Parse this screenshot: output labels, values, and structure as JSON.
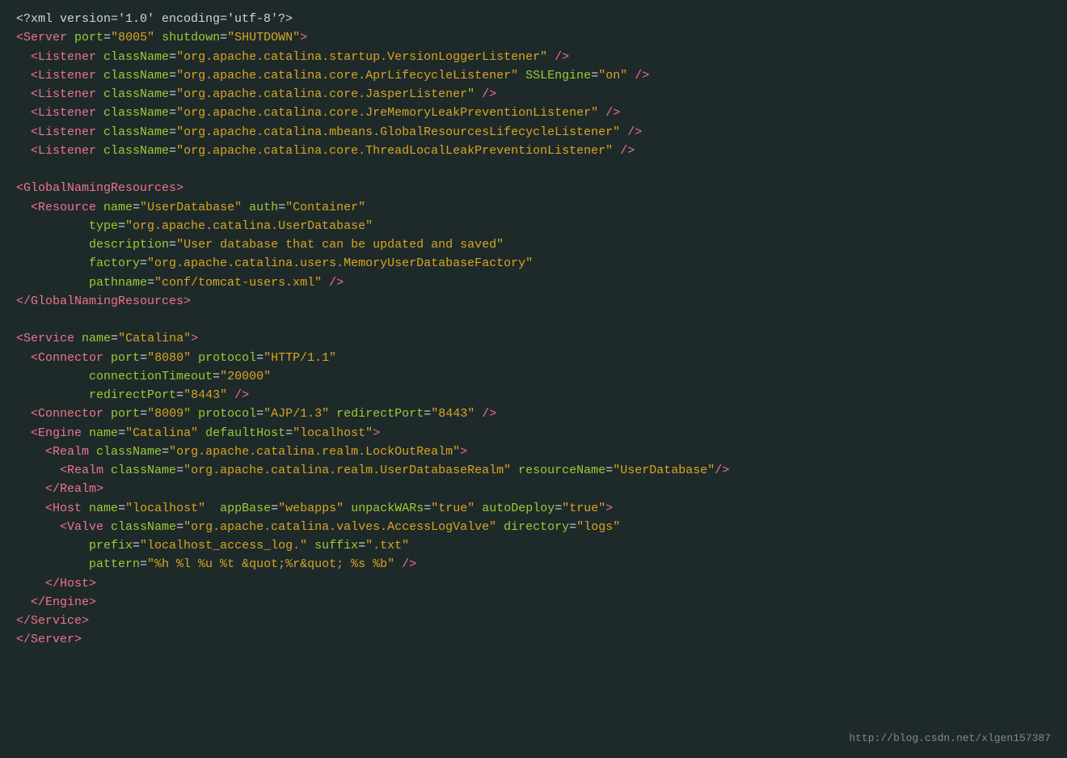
{
  "watermark": "http://blog.csdn.net/xlgen157387",
  "lines": [
    {
      "type": "prolog",
      "text": "<?xml version='1.0' encoding='utf-8'?>"
    },
    {
      "type": "mixed",
      "parts": [
        {
          "t": "tag",
          "v": "<Server"
        },
        {
          "t": "plain",
          "v": " "
        },
        {
          "t": "attr",
          "v": "port"
        },
        {
          "t": "plain",
          "v": "="
        },
        {
          "t": "val",
          "v": "\"8005\""
        },
        {
          "t": "plain",
          "v": " "
        },
        {
          "t": "attr",
          "v": "shutdown"
        },
        {
          "t": "plain",
          "v": "="
        },
        {
          "t": "val",
          "v": "\"SHUTDOWN\""
        },
        {
          "t": "tag",
          "v": ">"
        }
      ]
    },
    {
      "type": "mixed",
      "parts": [
        {
          "t": "plain",
          "v": "  "
        },
        {
          "t": "tag",
          "v": "<Listener"
        },
        {
          "t": "plain",
          "v": " "
        },
        {
          "t": "attr",
          "v": "className"
        },
        {
          "t": "plain",
          "v": "="
        },
        {
          "t": "val",
          "v": "\"org.apache.catalina.startup.VersionLoggerListener\""
        },
        {
          "t": "plain",
          "v": " "
        },
        {
          "t": "tag",
          "v": "/>"
        }
      ]
    },
    {
      "type": "mixed",
      "parts": [
        {
          "t": "plain",
          "v": "  "
        },
        {
          "t": "tag",
          "v": "<Listener"
        },
        {
          "t": "plain",
          "v": " "
        },
        {
          "t": "attr",
          "v": "className"
        },
        {
          "t": "plain",
          "v": "="
        },
        {
          "t": "val",
          "v": "\"org.apache.catalina.core.AprLifecycleListener\""
        },
        {
          "t": "plain",
          "v": " "
        },
        {
          "t": "attr",
          "v": "SSLEngine"
        },
        {
          "t": "plain",
          "v": "="
        },
        {
          "t": "val",
          "v": "\"on\""
        },
        {
          "t": "plain",
          "v": " "
        },
        {
          "t": "tag",
          "v": "/>"
        }
      ]
    },
    {
      "type": "mixed",
      "parts": [
        {
          "t": "plain",
          "v": "  "
        },
        {
          "t": "tag",
          "v": "<Listener"
        },
        {
          "t": "plain",
          "v": " "
        },
        {
          "t": "attr",
          "v": "className"
        },
        {
          "t": "plain",
          "v": "="
        },
        {
          "t": "val",
          "v": "\"org.apache.catalina.core.JasperListener\""
        },
        {
          "t": "plain",
          "v": " "
        },
        {
          "t": "tag",
          "v": "/>"
        }
      ]
    },
    {
      "type": "mixed",
      "parts": [
        {
          "t": "plain",
          "v": "  "
        },
        {
          "t": "tag",
          "v": "<Listener"
        },
        {
          "t": "plain",
          "v": " "
        },
        {
          "t": "attr",
          "v": "className"
        },
        {
          "t": "plain",
          "v": "="
        },
        {
          "t": "val",
          "v": "\"org.apache.catalina.core.JreMemoryLeakPreventionListener\""
        },
        {
          "t": "plain",
          "v": " "
        },
        {
          "t": "tag",
          "v": "/>"
        }
      ]
    },
    {
      "type": "mixed",
      "parts": [
        {
          "t": "plain",
          "v": "  "
        },
        {
          "t": "tag",
          "v": "<Listener"
        },
        {
          "t": "plain",
          "v": " "
        },
        {
          "t": "attr",
          "v": "className"
        },
        {
          "t": "plain",
          "v": "="
        },
        {
          "t": "val",
          "v": "\"org.apache.catalina.mbeans.GlobalResourcesLifecycleListener\""
        },
        {
          "t": "plain",
          "v": " "
        },
        {
          "t": "tag",
          "v": "/>"
        }
      ]
    },
    {
      "type": "mixed",
      "parts": [
        {
          "t": "plain",
          "v": "  "
        },
        {
          "t": "tag",
          "v": "<Listener"
        },
        {
          "t": "plain",
          "v": " "
        },
        {
          "t": "attr",
          "v": "className"
        },
        {
          "t": "plain",
          "v": "="
        },
        {
          "t": "val",
          "v": "\"org.apache.catalina.core.ThreadLocalLeakPreventionListener\""
        },
        {
          "t": "plain",
          "v": " "
        },
        {
          "t": "tag",
          "v": "/>"
        }
      ]
    },
    {
      "type": "blank"
    },
    {
      "type": "mixed",
      "parts": [
        {
          "t": "tag",
          "v": "<GlobalNamingResources"
        },
        {
          "t": "tag",
          "v": ">"
        }
      ]
    },
    {
      "type": "mixed",
      "parts": [
        {
          "t": "plain",
          "v": "  "
        },
        {
          "t": "tag",
          "v": "<Resource"
        },
        {
          "t": "plain",
          "v": " "
        },
        {
          "t": "attr",
          "v": "name"
        },
        {
          "t": "plain",
          "v": "="
        },
        {
          "t": "val",
          "v": "\"UserDatabase\""
        },
        {
          "t": "plain",
          "v": " "
        },
        {
          "t": "attr",
          "v": "auth"
        },
        {
          "t": "plain",
          "v": "="
        },
        {
          "t": "val",
          "v": "\"Container\""
        }
      ]
    },
    {
      "type": "mixed",
      "parts": [
        {
          "t": "plain",
          "v": "          "
        },
        {
          "t": "attr",
          "v": "type"
        },
        {
          "t": "plain",
          "v": "="
        },
        {
          "t": "val",
          "v": "\"org.apache.catalina.UserDatabase\""
        }
      ]
    },
    {
      "type": "mixed",
      "parts": [
        {
          "t": "plain",
          "v": "          "
        },
        {
          "t": "attr",
          "v": "description"
        },
        {
          "t": "plain",
          "v": "="
        },
        {
          "t": "val",
          "v": "\"User database that can be updated and saved\""
        }
      ]
    },
    {
      "type": "mixed",
      "parts": [
        {
          "t": "plain",
          "v": "          "
        },
        {
          "t": "attr",
          "v": "factory"
        },
        {
          "t": "plain",
          "v": "="
        },
        {
          "t": "val",
          "v": "\"org.apache.catalina.users.MemoryUserDatabaseFactory\""
        }
      ]
    },
    {
      "type": "mixed",
      "parts": [
        {
          "t": "plain",
          "v": "          "
        },
        {
          "t": "attr",
          "v": "pathname"
        },
        {
          "t": "plain",
          "v": "="
        },
        {
          "t": "val",
          "v": "\"conf/tomcat-users.xml\""
        },
        {
          "t": "plain",
          "v": " "
        },
        {
          "t": "tag",
          "v": "/>"
        }
      ]
    },
    {
      "type": "mixed",
      "parts": [
        {
          "t": "tag",
          "v": "</GlobalNamingResources"
        },
        {
          "t": "tag",
          "v": ">"
        }
      ]
    },
    {
      "type": "blank"
    },
    {
      "type": "mixed",
      "parts": [
        {
          "t": "tag",
          "v": "<Service"
        },
        {
          "t": "plain",
          "v": " "
        },
        {
          "t": "attr",
          "v": "name"
        },
        {
          "t": "plain",
          "v": "="
        },
        {
          "t": "val",
          "v": "\"Catalina\""
        },
        {
          "t": "tag",
          "v": ">"
        }
      ]
    },
    {
      "type": "mixed",
      "parts": [
        {
          "t": "plain",
          "v": "  "
        },
        {
          "t": "tag",
          "v": "<Connector"
        },
        {
          "t": "plain",
          "v": " "
        },
        {
          "t": "attr",
          "v": "port"
        },
        {
          "t": "plain",
          "v": "="
        },
        {
          "t": "val",
          "v": "\"8080\""
        },
        {
          "t": "plain",
          "v": " "
        },
        {
          "t": "attr",
          "v": "protocol"
        },
        {
          "t": "plain",
          "v": "="
        },
        {
          "t": "val",
          "v": "\"HTTP/1.1\""
        }
      ]
    },
    {
      "type": "mixed",
      "parts": [
        {
          "t": "plain",
          "v": "          "
        },
        {
          "t": "attr",
          "v": "connectionTimeout"
        },
        {
          "t": "plain",
          "v": "="
        },
        {
          "t": "val",
          "v": "\"20000\""
        }
      ]
    },
    {
      "type": "mixed",
      "parts": [
        {
          "t": "plain",
          "v": "          "
        },
        {
          "t": "attr",
          "v": "redirectPort"
        },
        {
          "t": "plain",
          "v": "="
        },
        {
          "t": "val",
          "v": "\"8443\""
        },
        {
          "t": "plain",
          "v": " "
        },
        {
          "t": "tag",
          "v": "/>"
        }
      ]
    },
    {
      "type": "mixed",
      "parts": [
        {
          "t": "plain",
          "v": "  "
        },
        {
          "t": "tag",
          "v": "<Connector"
        },
        {
          "t": "plain",
          "v": " "
        },
        {
          "t": "attr",
          "v": "port"
        },
        {
          "t": "plain",
          "v": "="
        },
        {
          "t": "val",
          "v": "\"8009\""
        },
        {
          "t": "plain",
          "v": " "
        },
        {
          "t": "attr",
          "v": "protocol"
        },
        {
          "t": "plain",
          "v": "="
        },
        {
          "t": "val",
          "v": "\"AJP/1.3\""
        },
        {
          "t": "plain",
          "v": " "
        },
        {
          "t": "attr",
          "v": "redirectPort"
        },
        {
          "t": "plain",
          "v": "="
        },
        {
          "t": "val",
          "v": "\"8443\""
        },
        {
          "t": "plain",
          "v": " "
        },
        {
          "t": "tag",
          "v": "/>"
        }
      ]
    },
    {
      "type": "mixed",
      "parts": [
        {
          "t": "plain",
          "v": "  "
        },
        {
          "t": "tag",
          "v": "<Engine"
        },
        {
          "t": "plain",
          "v": " "
        },
        {
          "t": "attr",
          "v": "name"
        },
        {
          "t": "plain",
          "v": "="
        },
        {
          "t": "val",
          "v": "\"Catalina\""
        },
        {
          "t": "plain",
          "v": " "
        },
        {
          "t": "attr",
          "v": "defaultHost"
        },
        {
          "t": "plain",
          "v": "="
        },
        {
          "t": "val",
          "v": "\"localhost\""
        },
        {
          "t": "tag",
          "v": ">"
        }
      ]
    },
    {
      "type": "mixed",
      "parts": [
        {
          "t": "plain",
          "v": "    "
        },
        {
          "t": "tag",
          "v": "<Realm"
        },
        {
          "t": "plain",
          "v": " "
        },
        {
          "t": "attr",
          "v": "className"
        },
        {
          "t": "plain",
          "v": "="
        },
        {
          "t": "val",
          "v": "\"org.apache.catalina.realm.LockOutRealm\""
        },
        {
          "t": "tag",
          "v": ">"
        }
      ]
    },
    {
      "type": "mixed",
      "parts": [
        {
          "t": "plain",
          "v": "      "
        },
        {
          "t": "tag",
          "v": "<Realm"
        },
        {
          "t": "plain",
          "v": " "
        },
        {
          "t": "attr",
          "v": "className"
        },
        {
          "t": "plain",
          "v": "="
        },
        {
          "t": "val",
          "v": "\"org.apache.catalina.realm.UserDatabaseRealm\""
        },
        {
          "t": "plain",
          "v": " "
        },
        {
          "t": "attr",
          "v": "resourceName"
        },
        {
          "t": "plain",
          "v": "="
        },
        {
          "t": "val",
          "v": "\"UserDatabase\""
        },
        {
          "t": "tag",
          "v": "/>"
        }
      ]
    },
    {
      "type": "mixed",
      "parts": [
        {
          "t": "plain",
          "v": "    "
        },
        {
          "t": "tag",
          "v": "</Realm"
        },
        {
          "t": "tag",
          "v": ">"
        }
      ]
    },
    {
      "type": "mixed",
      "parts": [
        {
          "t": "plain",
          "v": "    "
        },
        {
          "t": "tag",
          "v": "<Host"
        },
        {
          "t": "plain",
          "v": " "
        },
        {
          "t": "attr",
          "v": "name"
        },
        {
          "t": "plain",
          "v": "="
        },
        {
          "t": "val",
          "v": "\"localhost\""
        },
        {
          "t": "plain",
          "v": "  "
        },
        {
          "t": "attr",
          "v": "appBase"
        },
        {
          "t": "plain",
          "v": "="
        },
        {
          "t": "val",
          "v": "\"webapps\""
        },
        {
          "t": "plain",
          "v": " "
        },
        {
          "t": "attr",
          "v": "unpackWARs"
        },
        {
          "t": "plain",
          "v": "="
        },
        {
          "t": "val",
          "v": "\"true\""
        },
        {
          "t": "plain",
          "v": " "
        },
        {
          "t": "attr",
          "v": "autoDeploy"
        },
        {
          "t": "plain",
          "v": "="
        },
        {
          "t": "val",
          "v": "\"true\""
        },
        {
          "t": "tag",
          "v": ">"
        }
      ]
    },
    {
      "type": "mixed",
      "parts": [
        {
          "t": "plain",
          "v": "      "
        },
        {
          "t": "tag",
          "v": "<Valve"
        },
        {
          "t": "plain",
          "v": " "
        },
        {
          "t": "attr",
          "v": "className"
        },
        {
          "t": "plain",
          "v": "="
        },
        {
          "t": "val",
          "v": "\"org.apache.catalina.valves.AccessLogValve\""
        },
        {
          "t": "plain",
          "v": " "
        },
        {
          "t": "attr",
          "v": "directory"
        },
        {
          "t": "plain",
          "v": "="
        },
        {
          "t": "val",
          "v": "\"logs\""
        }
      ]
    },
    {
      "type": "mixed",
      "parts": [
        {
          "t": "plain",
          "v": "          "
        },
        {
          "t": "attr",
          "v": "prefix"
        },
        {
          "t": "plain",
          "v": "="
        },
        {
          "t": "val",
          "v": "\"localhost_access_log.\""
        },
        {
          "t": "plain",
          "v": " "
        },
        {
          "t": "attr",
          "v": "suffix"
        },
        {
          "t": "plain",
          "v": "="
        },
        {
          "t": "val",
          "v": "\".txt\""
        }
      ]
    },
    {
      "type": "mixed",
      "parts": [
        {
          "t": "plain",
          "v": "          "
        },
        {
          "t": "attr",
          "v": "pattern"
        },
        {
          "t": "plain",
          "v": "="
        },
        {
          "t": "val",
          "v": "\"%h %l %u %t &quot;%r&quot; %s %b\""
        },
        {
          "t": "plain",
          "v": " "
        },
        {
          "t": "tag",
          "v": "/>"
        }
      ]
    },
    {
      "type": "mixed",
      "parts": [
        {
          "t": "plain",
          "v": "    "
        },
        {
          "t": "tag",
          "v": "</Host"
        },
        {
          "t": "tag",
          "v": ">"
        }
      ]
    },
    {
      "type": "mixed",
      "parts": [
        {
          "t": "plain",
          "v": "  "
        },
        {
          "t": "tag",
          "v": "</Engine"
        },
        {
          "t": "tag",
          "v": ">"
        }
      ]
    },
    {
      "type": "mixed",
      "parts": [
        {
          "t": "tag",
          "v": "</Service"
        },
        {
          "t": "tag",
          "v": ">"
        }
      ]
    },
    {
      "type": "mixed",
      "parts": [
        {
          "t": "tag",
          "v": "</Server"
        },
        {
          "t": "tag",
          "v": ">"
        }
      ]
    }
  ]
}
